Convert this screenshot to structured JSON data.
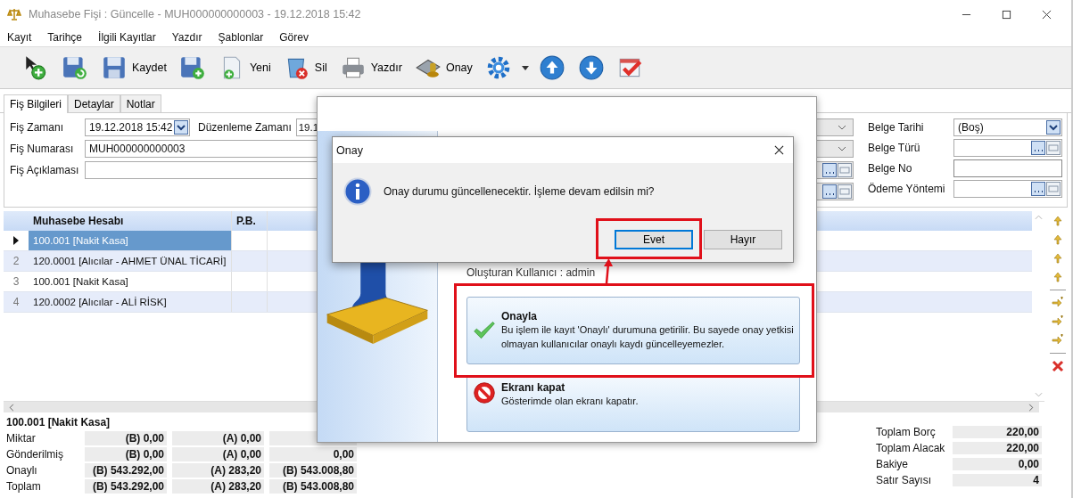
{
  "window": {
    "title": "Muhasebe Fişi : Güncelle - MUH000000000003 - 19.12.2018 15:42"
  },
  "menu": [
    "Kayıt",
    "Tarihçe",
    "İlgili Kayıtlar",
    "Yazdır",
    "Şablonlar",
    "Görev"
  ],
  "toolbar": {
    "save": "Kaydet",
    "new": "Yeni",
    "delete": "Sil",
    "print": "Yazdır",
    "approve": "Onay"
  },
  "tabs": [
    {
      "label": "Fiş Bilgileri",
      "selected": true
    },
    {
      "label": "Detaylar",
      "selected": false
    },
    {
      "label": "Notlar",
      "selected": false
    }
  ],
  "form": {
    "fis_zamani": {
      "label": "Fiş Zamanı",
      "value": "19.12.2018 15:42"
    },
    "duzenleme_zamani": {
      "label": "Düzenleme Zamanı",
      "value": "19.1"
    },
    "fis_numarasi": {
      "label": "Fiş Numarası",
      "value": "MUH000000000003"
    },
    "fis_aciklamasi": {
      "label": "Fiş Açıklaması"
    },
    "right": [
      {
        "label": "Belge Tarihi",
        "value": "(Boş)",
        "kind": "date"
      },
      {
        "label": "Belge Türü",
        "kind": "lookup"
      },
      {
        "label": "Belge No",
        "kind": "text"
      },
      {
        "label": "Ödeme Yöntemi",
        "kind": "lookup"
      }
    ]
  },
  "grid": {
    "columns": [
      "Muhasebe Hesabı",
      "P.B."
    ],
    "rows": [
      {
        "account": "100.001 [Nakit Kasa]",
        "selected": true
      },
      {
        "number": "2",
        "account": "120.0001 [Alıcılar - AHMET ÜNAL TİCARİ]",
        "selected": false
      },
      {
        "number": "3",
        "account": "100.001 [Nakit Kasa]",
        "selected": false
      },
      {
        "number": "4",
        "account": "120.0002 [Alıcılar - ALİ RİSK]",
        "selected": false
      }
    ]
  },
  "summary": {
    "title": "100.001 [Nakit Kasa]",
    "rows": [
      {
        "label": "Miktar",
        "values": [
          "(B) 0,00",
          "(A) 0,00"
        ]
      },
      {
        "label": "Gönderilmiş",
        "values": [
          "(B) 0,00",
          "(A) 0,00",
          "0,00"
        ]
      },
      {
        "label": "Onaylı",
        "values": [
          "(B) 543.292,00",
          "(A) 283,20",
          "(B) 543.008,80"
        ]
      },
      {
        "label": "Toplam",
        "values": [
          "(B) 543.292,00",
          "(A) 283,20",
          "(B) 543.008,80"
        ]
      }
    ]
  },
  "totals": [
    {
      "label": "Toplam Borç",
      "value": "220,00"
    },
    {
      "label": "Toplam Alacak",
      "value": "220,00"
    },
    {
      "label": "Bakiye",
      "value": "0,00"
    },
    {
      "label": "Satır Sayısı",
      "value": "4"
    }
  ],
  "approval_panel": {
    "info_label": "Oluşturan Kullanıcı :",
    "info_value": "admin",
    "options": [
      {
        "kind": "approve",
        "title": "Onayla",
        "text": "Bu işlem ile kayıt 'Onaylı' durumuna getirilir. Bu sayede onay yetkisi olmayan kullanıcılar onaylı kaydı güncelleyemezler."
      },
      {
        "kind": "close",
        "title": "Ekranı kapat",
        "text": "Gösterimde olan ekranı kapatır."
      }
    ]
  },
  "dialog": {
    "title": "Onay",
    "message": "Onay durumu güncellenecektir. İşleme devam edilsin mi?",
    "buttons": [
      {
        "label": "Evet",
        "focused": true
      },
      {
        "label": "Hayır",
        "focused": false
      }
    ]
  }
}
